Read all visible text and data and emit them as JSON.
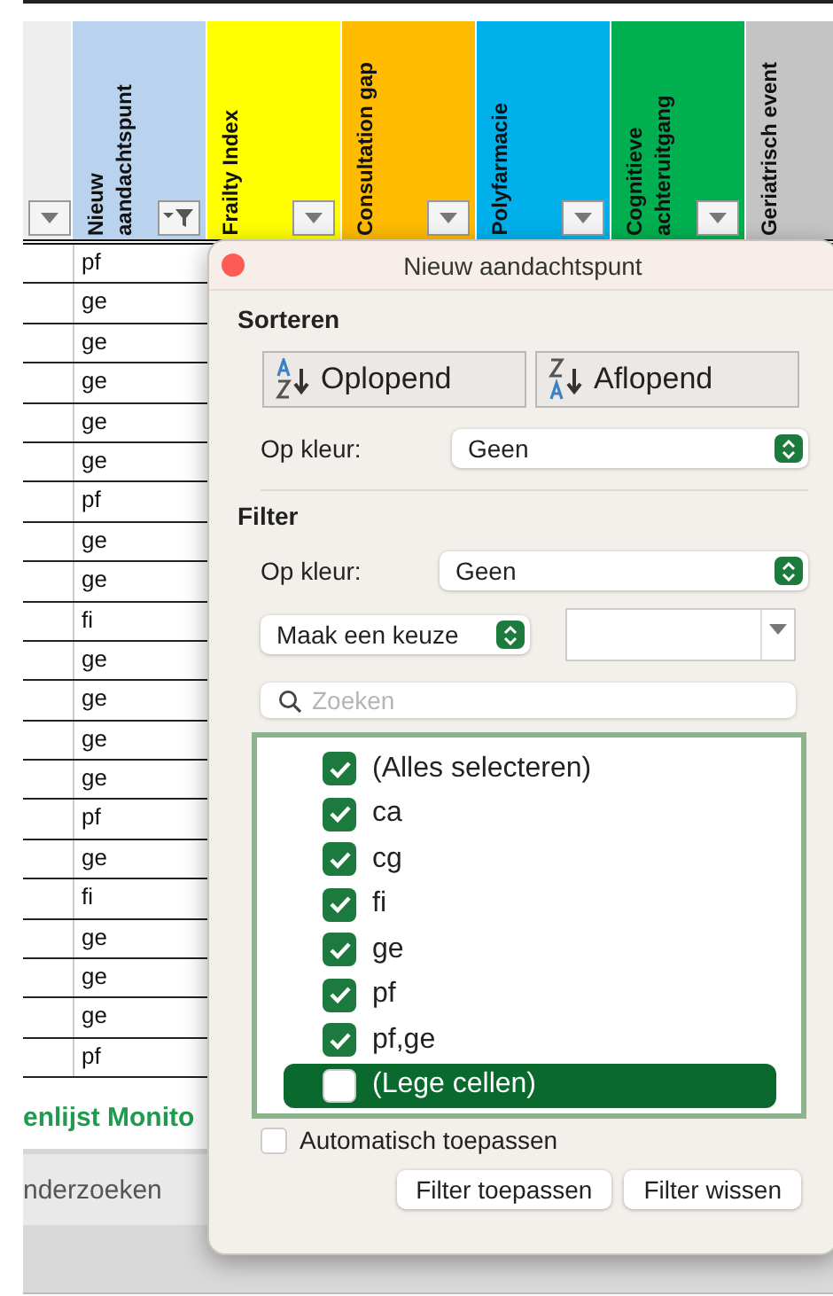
{
  "columns": [
    {
      "color": "#eeeeee",
      "filter_active": false
    },
    {
      "label": "Nieuw aandachtspunt",
      "color": "#b9d3ee",
      "filter_active": true
    },
    {
      "label": "Frailty Index",
      "color": "#ffff00",
      "filter_active": false
    },
    {
      "label": "Consultation gap",
      "color": "#ffbb00",
      "filter_active": false
    },
    {
      "label": "Polyfarmacie",
      "color": "#00b0eb",
      "filter_active": false
    },
    {
      "label": "Cognitieve achteruitgang",
      "color": "#00b050",
      "filter_active": false
    },
    {
      "label": "Geriatrisch event",
      "color": "#c4c4c4"
    }
  ],
  "rows": [
    "pf",
    "ge",
    "ge",
    "ge",
    "ge",
    "ge",
    "pf",
    "ge",
    "ge",
    "fi",
    "ge",
    "ge",
    "ge",
    "ge",
    "pf",
    "ge",
    "fi",
    "ge",
    "ge",
    "ge",
    "pf"
  ],
  "sheet_title": "enlijst Monito",
  "sheet_tab": "nderzoeken",
  "dialog": {
    "title": "Nieuw aandachtspunt",
    "sort": {
      "heading": "Sorteren",
      "ascending": "Oplopend",
      "descending": "Aflopend",
      "color_label": "Op kleur:",
      "color_value": "Geen"
    },
    "filter": {
      "heading": "Filter",
      "color_label": "Op kleur:",
      "color_value": "Geen",
      "condition": "Maak een keuze",
      "search_placeholder": "Zoeken",
      "items": [
        {
          "label": "(Alles selecteren)",
          "checked": true,
          "selected": false
        },
        {
          "label": "ca",
          "checked": true,
          "selected": false
        },
        {
          "label": "cg",
          "checked": true,
          "selected": false
        },
        {
          "label": "fi",
          "checked": true,
          "selected": false
        },
        {
          "label": "ge",
          "checked": true,
          "selected": false
        },
        {
          "label": "pf",
          "checked": true,
          "selected": false
        },
        {
          "label": "pf,ge",
          "checked": true,
          "selected": false
        },
        {
          "label": "(Lege cellen)",
          "checked": false,
          "selected": true
        }
      ],
      "auto_apply": {
        "label": "Automatisch toepassen",
        "checked": false
      },
      "buttons": [
        "Filter toepassen",
        "Filter wissen"
      ]
    }
  }
}
